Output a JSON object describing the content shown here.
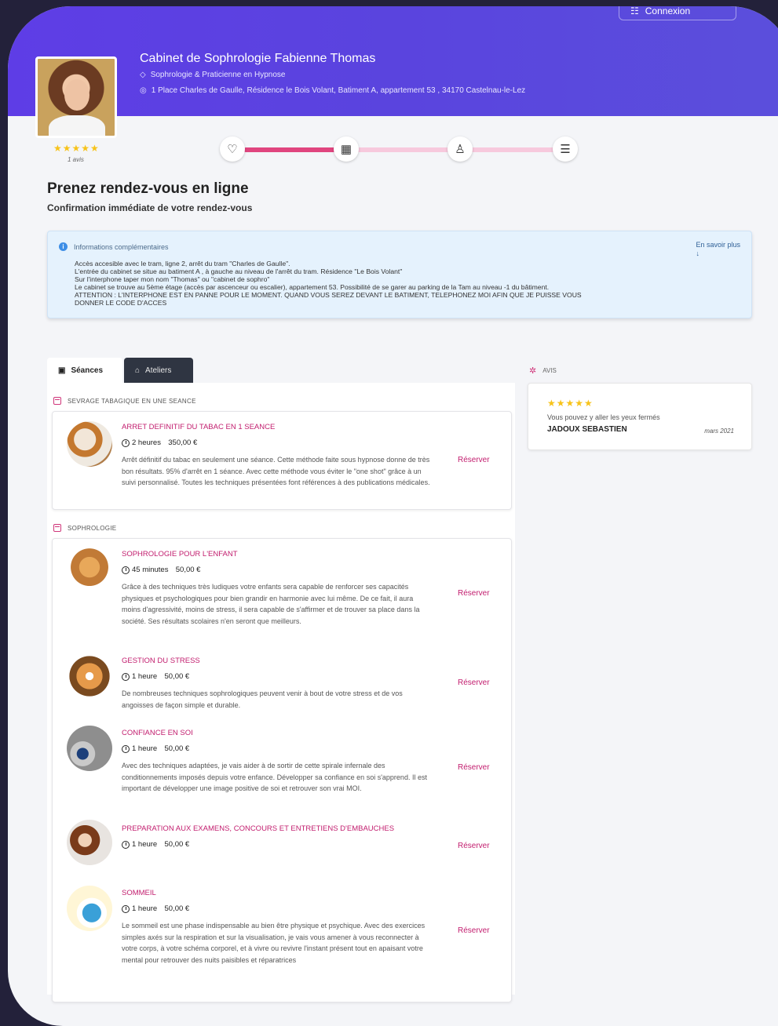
{
  "header": {
    "login_label": "Connexion",
    "cabinet_name": "Cabinet de Sophrologie Fabienne Thomas",
    "specialty": "Sophrologie & Praticienne en Hypnose",
    "address": "1 Place Charles de Gaulle, Résidence le Bois Volant, Batiment A, appartement 53 , 34170 Castelnau-le-Lez",
    "rating_stars": "★★★★★",
    "rating_count": "1 avis"
  },
  "steps": {
    "icons": [
      "heart-icon",
      "calendar-icon",
      "user-icon",
      "checklist-icon"
    ],
    "progress_fraction": 0.333
  },
  "page": {
    "title": "Prenez rendez-vous en ligne",
    "subtitle": "Confirmation immédiate de votre rendez-vous"
  },
  "info": {
    "title": "Informations complémentaires",
    "more_link": "En savoir plus",
    "more_arrow": "↓",
    "body": "Accès accesible avec le tram, ligne 2, arrêt du tram \"Charles de Gaulle\".\nL'entrée du cabinet se situe au batiment A , à gauche au niveau de l'arrêt du tram. Résidence \"Le Bois Volant\"\nSur l'interphone taper mon nom \"Thomas\" ou \"cabinet de sophro\"\nLe cabinet se trouve au 5ème étage (accès par ascenceur ou escalier), appartement 53. Possibilité de se garer au parking de la Tam au niveau -1 du bâtiment.\nATTENTION : L'INTERPHONE EST EN PANNE POUR LE MOMENT. QUAND VOUS SEREZ DEVANT LE BATIMENT, TELEPHONEZ MOI AFIN QUE JE PUISSE VOUS\nDONNER LE CODE D'ACCES"
  },
  "tabs": [
    {
      "label": "Séances",
      "active": true
    },
    {
      "label": "Ateliers",
      "active": false
    }
  ],
  "sections": [
    {
      "title": "SEVRAGE TABAGIQUE EN UNE SEANCE",
      "services": [
        {
          "title": "ARRET DEFINITIF DU TABAC EN 1 SEANCE",
          "duration": "2 heures",
          "price": "350,00 €",
          "description": "Arrêt définitif du tabac en seulement une séance. Cette méthode faite sous hypnose donne de très bon résultats. 95% d'arrêt en 1 séance. Avec cette méthode vous éviter le \"one shot\" grâce à un suivi personnalisé. Toutes les techniques présentées font références à des publications médicales.",
          "reserve_label": "Réserver"
        }
      ]
    },
    {
      "title": "SOPHROLOGIE",
      "services": [
        {
          "title": "SOPHROLOGIE POUR L'ENFANT",
          "duration": "45 minutes",
          "price": "50,00 €",
          "description": "Grâce à des techniques très ludiques votre enfants sera capable de renforcer ses capacités physiques et psychologiques pour bien grandir en harmonie avec lui même. De ce fait, il aura moins d'agressivité, moins de stress, il sera capable de s'affirmer et de trouver sa place dans la société. Ses résultats scolaires n'en seront que meilleurs.",
          "reserve_label": "Réserver"
        },
        {
          "title": "GESTION DU STRESS",
          "duration": "1 heure",
          "price": "50,00 €",
          "description": "De nombreuses techniques sophrologiques peuvent venir à bout de votre stress et de vos angoisses de façon simple et durable.",
          "reserve_label": "Réserver"
        },
        {
          "title": "CONFIANCE EN SOI",
          "duration": "1 heure",
          "price": "50,00 €",
          "description": "Avec des techniques adaptées, je vais aider à de sortir de cette spirale infernale des conditionnements imposés depuis votre enfance. Développer sa confiance en soi s'apprend. Il est important de développer une image positive de soi et retrouver son vrai MOI.",
          "reserve_label": "Réserver"
        },
        {
          "title": "PREPARATION AUX EXAMENS, CONCOURS ET ENTRETIENS D'EMBAUCHES",
          "duration": "1 heure",
          "price": "50,00 €",
          "description": "",
          "reserve_label": "Réserver"
        },
        {
          "title": "SOMMEIL",
          "duration": "1 heure",
          "price": "50,00 €",
          "description": "Le sommeil est une phase indispensable au bien être physique et psychique. Avec des exercices simples axés sur la respiration et sur la visualisation, je vais vous amener à vous reconnecter à votre corps, à votre schéma corporel, et à vivre ou revivre l'instant présent tout en apaisant votre mental pour retrouver des nuits paisibles et réparatrices",
          "reserve_label": "Réserver"
        }
      ]
    }
  ],
  "reviews": {
    "title": "AVIS",
    "items": [
      {
        "stars": "★★★★★",
        "text": "Vous pouvez y aller les yeux fermés",
        "author": "JADOUX SEBASTIEN",
        "date": "mars 2021"
      }
    ]
  },
  "colors": {
    "header": "#5b44e0",
    "accent": "#c21d6e",
    "progress_done": "#e0457f",
    "progress_todo": "#f7c9dd",
    "star": "#f7c31a"
  }
}
